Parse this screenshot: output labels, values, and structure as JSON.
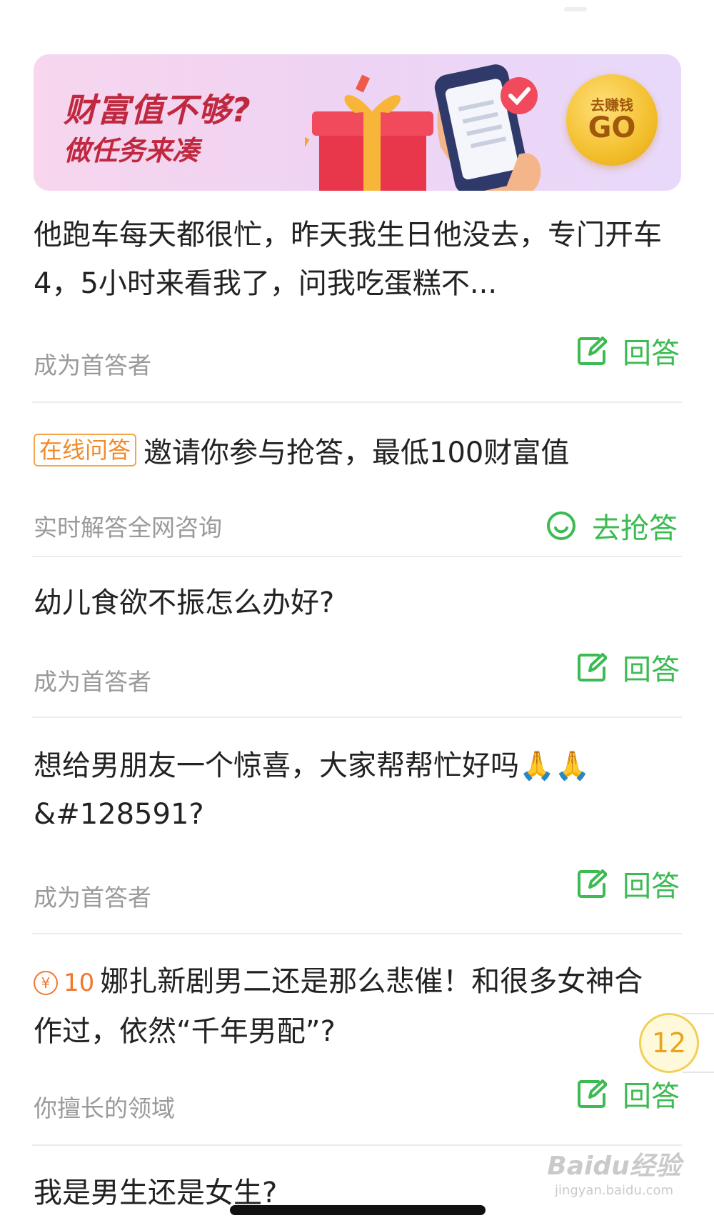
{
  "banner": {
    "line1": "财富值不够?",
    "line2": "做任务来凑",
    "go_small": "去赚钱",
    "go_big": "GO",
    "accent": "#c0283f"
  },
  "questions": [
    {
      "title": "他跑车每天都很忙，昨天我生日他没去，专门开车4，5小时来看我了，问我吃蛋糕不...",
      "sub": "成为首答者",
      "action_label": "回答",
      "action_icon": "edit-icon"
    },
    {
      "tag": "在线问答",
      "title": "邀请你参与抢答，最低100财富值",
      "sub": "实时解答全网咨询",
      "action_label": "去抢答",
      "action_icon": "smile-icon"
    },
    {
      "title": "幼儿食欲不振怎么办好?",
      "sub": "成为首答者",
      "action_label": "回答",
      "action_icon": "edit-icon"
    },
    {
      "title": "想给男朋友一个惊喜，大家帮帮忙好吗🙏🙏&#128591?",
      "sub": "成为首答者",
      "action_label": "回答",
      "action_icon": "edit-icon"
    },
    {
      "reward_symbol": "¥",
      "reward_amount": "10",
      "title": "娜扎新剧男二还是那么悲催！和很多女神合作过，依然“千年男配”?",
      "sub": "你擅长的领域",
      "action_label": "回答",
      "action_icon": "edit-icon"
    },
    {
      "title": "我是男生还是女生?"
    }
  ],
  "float_badge": "12",
  "watermark": {
    "main": "Baidu经验",
    "url": "jingyan.baidu.com"
  },
  "colors": {
    "action_green": "#3cbb52",
    "reward_orange": "#f07830",
    "tag_orange": "#f08a2a"
  }
}
